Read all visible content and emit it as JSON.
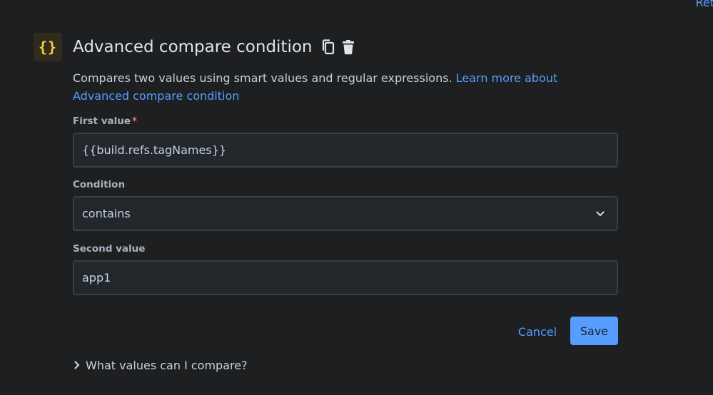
{
  "top_link": {
    "label": "Ret"
  },
  "header": {
    "icon_glyph": "{}",
    "title": "Advanced compare condition",
    "icons": {
      "copy": "copy-icon",
      "delete": "trash-icon"
    }
  },
  "description": {
    "text": "Compares two values using smart values and regular expressions.",
    "link": "Learn more about Advanced compare condition"
  },
  "form": {
    "first_value": {
      "label": "First value",
      "required_mark": "*",
      "value": "{{build.refs.tagNames}}"
    },
    "condition": {
      "label": "Condition",
      "value": "contains"
    },
    "second_value": {
      "label": "Second value",
      "value": "app1"
    }
  },
  "actions": {
    "cancel": "Cancel",
    "save": "Save"
  },
  "expander": {
    "label": "What values can I compare?"
  },
  "colors": {
    "background": "#1e1f21",
    "accent": "#579dff",
    "brace_icon": "#f5cd47",
    "required": "#f87168"
  }
}
